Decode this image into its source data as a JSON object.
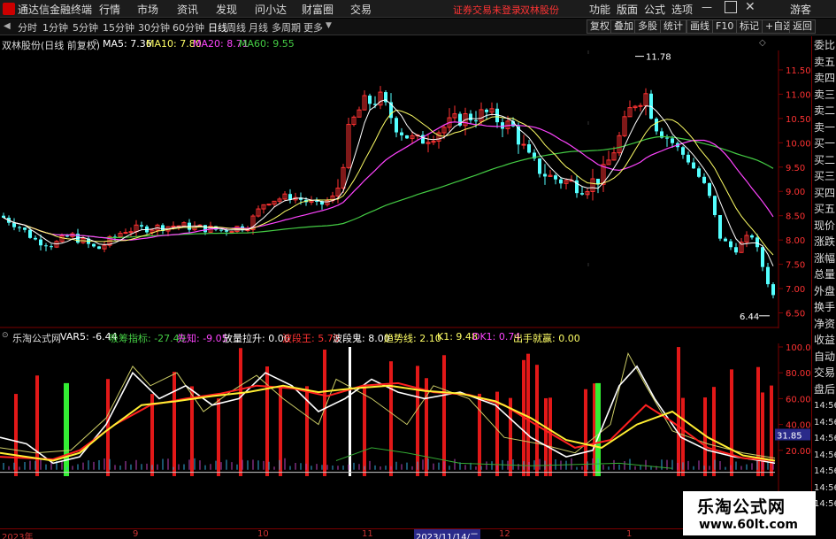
{
  "app": {
    "title": "通达信金融终端"
  },
  "menu": [
    "行情",
    "市场",
    "资讯",
    "发现",
    "问小达",
    "财富圈",
    "交易"
  ],
  "status_warning": "证券交易未登录",
  "stock_name_top": "双林股份",
  "menu_right": [
    "功能",
    "版面",
    "公式",
    "选项"
  ],
  "guest": "游客",
  "periods": [
    "分时",
    "1分钟",
    "5分钟",
    "15分钟",
    "30分钟",
    "60分钟",
    "日线",
    "周线",
    "月线",
    "多周期",
    "更多"
  ],
  "active_period": "日线",
  "toolbar_right": [
    "复权",
    "叠加",
    "多股",
    "统计",
    "画线",
    "F10",
    "标记",
    "+自选",
    "返回"
  ],
  "price_header": {
    "title": "双林股份(日线 前复权)",
    "ma5": "MA5: 7.36",
    "ma10": "MA10: 7.80",
    "ma20": "MA20: 8.71",
    "ma60": "MA60: 9.55"
  },
  "colors": {
    "up": "#ff3232",
    "down": "#54ffff",
    "ma5": "#ffffff",
    "ma10": "#ffff66",
    "ma20": "#ff44ff",
    "ma60": "#44cc44",
    "border": "#7a0000"
  },
  "price_axis": [
    "11.50",
    "11.00",
    "10.50",
    "10.00",
    "9.50",
    "9.00",
    "8.50",
    "8.00",
    "7.50",
    "7.00",
    "6.50"
  ],
  "price_high_label": "11.78",
  "price_low_label": "6.44",
  "indicator_header": {
    "name": "乐淘公式网",
    "var5": "VAR5: -6.44",
    "xichou": "吸筹指标: -27.40",
    "xianzhi": "先知: -9.05",
    "fangliang": "放量拉升: 0.00",
    "boduanwang": "波段王: 5.70",
    "boduangui": "波段鬼: 8.00",
    "qushixian": "趋势线: 2.10",
    "k1": "K1: 9.48",
    "dk1": "DK1: 0.74",
    "chushou": "出手就赢: 0.00"
  },
  "indicator_axis": [
    "100.0",
    "80.00",
    "60.00",
    "40.00",
    "20.00"
  ],
  "indicator_marker": "31.85",
  "right_panel": [
    "委比",
    "卖五",
    "卖四",
    "卖三",
    "卖二",
    "卖一",
    "买一",
    "买二",
    "买三",
    "买四",
    "买五",
    "现价",
    "涨跌",
    "涨幅",
    "总量",
    "外盘",
    "换手",
    "净资",
    "收益",
    "自动",
    "交易",
    "盘后",
    "14:56",
    "14:56",
    "14:56",
    "14:56",
    "14:56",
    "14:56",
    "14:56"
  ],
  "x_axis": [
    "2023年",
    "9",
    "10",
    "11",
    "2023/11/14/二",
    "12",
    "1"
  ],
  "watermark": {
    "site": "乐淘公式网",
    "url": "www.60lt.com"
  }
}
